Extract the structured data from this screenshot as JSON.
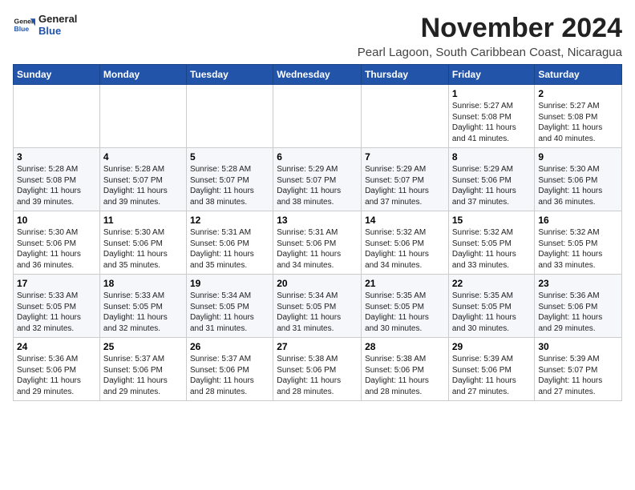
{
  "logo": {
    "line1": "General",
    "line2": "Blue"
  },
  "title": "November 2024",
  "location": "Pearl Lagoon, South Caribbean Coast, Nicaragua",
  "weekdays": [
    "Sunday",
    "Monday",
    "Tuesday",
    "Wednesday",
    "Thursday",
    "Friday",
    "Saturday"
  ],
  "weeks": [
    [
      {
        "day": "",
        "info": ""
      },
      {
        "day": "",
        "info": ""
      },
      {
        "day": "",
        "info": ""
      },
      {
        "day": "",
        "info": ""
      },
      {
        "day": "",
        "info": ""
      },
      {
        "day": "1",
        "info": "Sunrise: 5:27 AM\nSunset: 5:08 PM\nDaylight: 11 hours\nand 41 minutes."
      },
      {
        "day": "2",
        "info": "Sunrise: 5:27 AM\nSunset: 5:08 PM\nDaylight: 11 hours\nand 40 minutes."
      }
    ],
    [
      {
        "day": "3",
        "info": "Sunrise: 5:28 AM\nSunset: 5:08 PM\nDaylight: 11 hours\nand 39 minutes."
      },
      {
        "day": "4",
        "info": "Sunrise: 5:28 AM\nSunset: 5:07 PM\nDaylight: 11 hours\nand 39 minutes."
      },
      {
        "day": "5",
        "info": "Sunrise: 5:28 AM\nSunset: 5:07 PM\nDaylight: 11 hours\nand 38 minutes."
      },
      {
        "day": "6",
        "info": "Sunrise: 5:29 AM\nSunset: 5:07 PM\nDaylight: 11 hours\nand 38 minutes."
      },
      {
        "day": "7",
        "info": "Sunrise: 5:29 AM\nSunset: 5:07 PM\nDaylight: 11 hours\nand 37 minutes."
      },
      {
        "day": "8",
        "info": "Sunrise: 5:29 AM\nSunset: 5:06 PM\nDaylight: 11 hours\nand 37 minutes."
      },
      {
        "day": "9",
        "info": "Sunrise: 5:30 AM\nSunset: 5:06 PM\nDaylight: 11 hours\nand 36 minutes."
      }
    ],
    [
      {
        "day": "10",
        "info": "Sunrise: 5:30 AM\nSunset: 5:06 PM\nDaylight: 11 hours\nand 36 minutes."
      },
      {
        "day": "11",
        "info": "Sunrise: 5:30 AM\nSunset: 5:06 PM\nDaylight: 11 hours\nand 35 minutes."
      },
      {
        "day": "12",
        "info": "Sunrise: 5:31 AM\nSunset: 5:06 PM\nDaylight: 11 hours\nand 35 minutes."
      },
      {
        "day": "13",
        "info": "Sunrise: 5:31 AM\nSunset: 5:06 PM\nDaylight: 11 hours\nand 34 minutes."
      },
      {
        "day": "14",
        "info": "Sunrise: 5:32 AM\nSunset: 5:06 PM\nDaylight: 11 hours\nand 34 minutes."
      },
      {
        "day": "15",
        "info": "Sunrise: 5:32 AM\nSunset: 5:05 PM\nDaylight: 11 hours\nand 33 minutes."
      },
      {
        "day": "16",
        "info": "Sunrise: 5:32 AM\nSunset: 5:05 PM\nDaylight: 11 hours\nand 33 minutes."
      }
    ],
    [
      {
        "day": "17",
        "info": "Sunrise: 5:33 AM\nSunset: 5:05 PM\nDaylight: 11 hours\nand 32 minutes."
      },
      {
        "day": "18",
        "info": "Sunrise: 5:33 AM\nSunset: 5:05 PM\nDaylight: 11 hours\nand 32 minutes."
      },
      {
        "day": "19",
        "info": "Sunrise: 5:34 AM\nSunset: 5:05 PM\nDaylight: 11 hours\nand 31 minutes."
      },
      {
        "day": "20",
        "info": "Sunrise: 5:34 AM\nSunset: 5:05 PM\nDaylight: 11 hours\nand 31 minutes."
      },
      {
        "day": "21",
        "info": "Sunrise: 5:35 AM\nSunset: 5:05 PM\nDaylight: 11 hours\nand 30 minutes."
      },
      {
        "day": "22",
        "info": "Sunrise: 5:35 AM\nSunset: 5:05 PM\nDaylight: 11 hours\nand 30 minutes."
      },
      {
        "day": "23",
        "info": "Sunrise: 5:36 AM\nSunset: 5:06 PM\nDaylight: 11 hours\nand 29 minutes."
      }
    ],
    [
      {
        "day": "24",
        "info": "Sunrise: 5:36 AM\nSunset: 5:06 PM\nDaylight: 11 hours\nand 29 minutes."
      },
      {
        "day": "25",
        "info": "Sunrise: 5:37 AM\nSunset: 5:06 PM\nDaylight: 11 hours\nand 29 minutes."
      },
      {
        "day": "26",
        "info": "Sunrise: 5:37 AM\nSunset: 5:06 PM\nDaylight: 11 hours\nand 28 minutes."
      },
      {
        "day": "27",
        "info": "Sunrise: 5:38 AM\nSunset: 5:06 PM\nDaylight: 11 hours\nand 28 minutes."
      },
      {
        "day": "28",
        "info": "Sunrise: 5:38 AM\nSunset: 5:06 PM\nDaylight: 11 hours\nand 28 minutes."
      },
      {
        "day": "29",
        "info": "Sunrise: 5:39 AM\nSunset: 5:06 PM\nDaylight: 11 hours\nand 27 minutes."
      },
      {
        "day": "30",
        "info": "Sunrise: 5:39 AM\nSunset: 5:07 PM\nDaylight: 11 hours\nand 27 minutes."
      }
    ]
  ]
}
